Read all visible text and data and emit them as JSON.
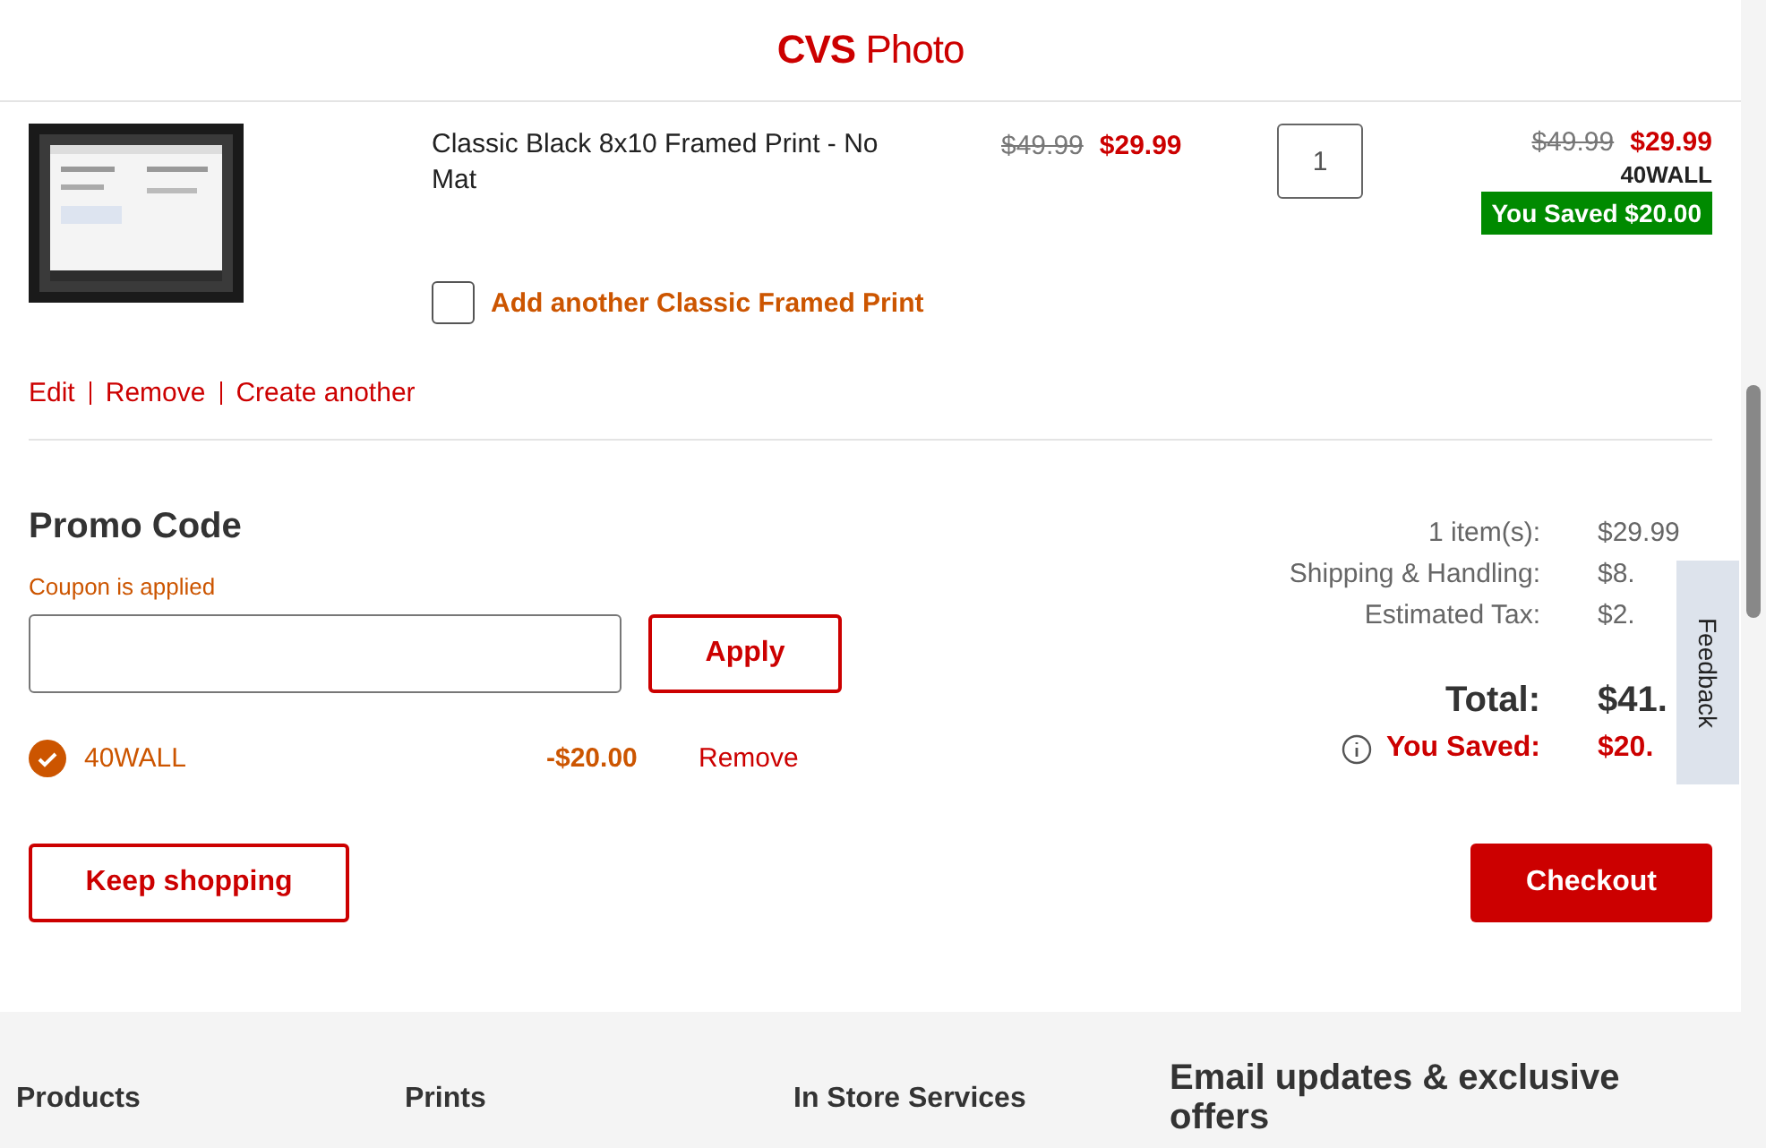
{
  "logo": {
    "brand": "CVS",
    "product": "Photo"
  },
  "cart_item": {
    "kind": "picture",
    "name": "Classic Black 8x10 Framed Print - No Mat",
    "original_price": "$49.99",
    "sale_price": "$29.99",
    "quantity": "1",
    "line_original_price": "$49.99",
    "line_sale_price": "$29.99",
    "promo_code": "40WALL",
    "saved_badge": "You Saved $20.00",
    "add_another": {
      "label": "Add another Classic Framed Print",
      "checked": false
    },
    "links": [
      "Edit",
      "Remove",
      "Create another"
    ]
  },
  "promo": {
    "title": "Promo Code",
    "status": "Coupon is applied",
    "apply_button": "Apply",
    "applied": {
      "code": "40WALL",
      "amount": "-$20.00",
      "remove": "Remove"
    }
  },
  "summary": {
    "rows": [
      {
        "label": "1 item(s):",
        "value": "$29.99"
      },
      {
        "label": "Shipping & Handling:",
        "value": "$8."
      },
      {
        "label": "Estimated Tax:",
        "value": "$2."
      }
    ],
    "total": {
      "label": "Total:",
      "value": "$41."
    },
    "saved": {
      "label": "You Saved:",
      "value": "$20."
    }
  },
  "buttons": {
    "keep_shopping": "Keep shopping",
    "checkout": "Checkout"
  },
  "feedback_tab": "Feedback",
  "footer": {
    "columns": [
      {
        "title": "Products"
      },
      {
        "title": "Prints"
      },
      {
        "title": "In Store Services"
      }
    ],
    "newsletter_title": "Email updates & exclusive offers"
  }
}
